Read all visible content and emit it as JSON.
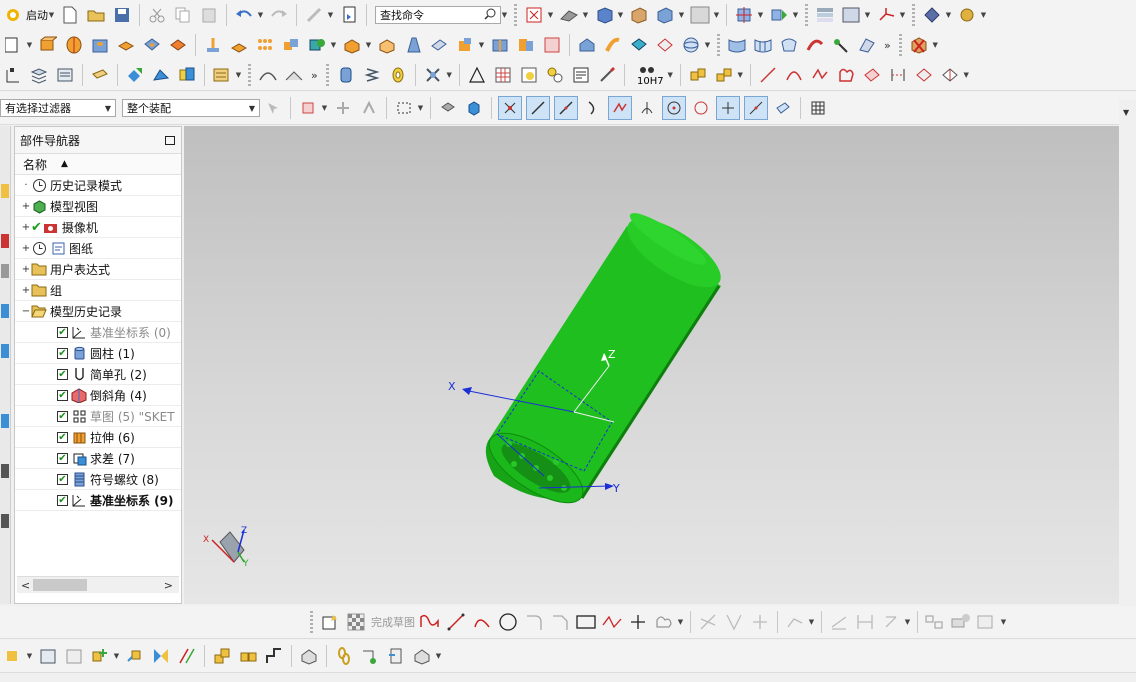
{
  "colors": {
    "model_green": "#1fc21f",
    "sketch_blue": "#1a2fd6",
    "navigator_bg": "#ffffff",
    "toolbar_bg": "#f3f3f3"
  },
  "toolbar_row1": {
    "start_label": "启动",
    "command_search_placeholder": "查找命令"
  },
  "selection_bar": {
    "filter_value": "有选择过滤器",
    "scope_value": "整个装配"
  },
  "sketch_toolbar": {
    "finish_sketch_label": "完成草图"
  },
  "navigator": {
    "title": "部件导航器",
    "column_name": "名称",
    "nodes": [
      {
        "label": "历史记录模式",
        "icon": "clock-icon"
      },
      {
        "label": "模型视图",
        "icon": "model-view-icon"
      },
      {
        "label": "摄像机",
        "icon": "camera-icon"
      },
      {
        "label": "图纸",
        "icon": "drawing-sheet-icon"
      },
      {
        "label": "用户表达式",
        "icon": "folder-icon"
      },
      {
        "label": "组",
        "icon": "folder-icon"
      },
      {
        "label": "模型历史记录",
        "icon": "folder-open-icon"
      }
    ],
    "features": [
      {
        "label": "基准坐标系 (0)",
        "icon": "datum-csys-icon"
      },
      {
        "label": "圆柱 (1)",
        "icon": "cylinder-icon"
      },
      {
        "label": "简单孔 (2)",
        "icon": "hole-icon"
      },
      {
        "label": "倒斜角 (4)",
        "icon": "chamfer-icon"
      },
      {
        "label": "草图 (5) \"SKET",
        "icon": "sketch-icon"
      },
      {
        "label": "拉伸 (6)",
        "icon": "extrude-icon"
      },
      {
        "label": "求差 (7)",
        "icon": "subtract-icon"
      },
      {
        "label": "符号螺纹 (8)",
        "icon": "thread-icon"
      },
      {
        "label": "基准坐标系 (9)",
        "icon": "datum-csys-icon"
      }
    ]
  },
  "viewport": {
    "axis_x": "X",
    "axis_y": "Y",
    "axis_z": "Z",
    "triad_x": "X",
    "triad_y": "Y",
    "triad_z": "Z"
  },
  "status_bar": {
    "text": ""
  }
}
